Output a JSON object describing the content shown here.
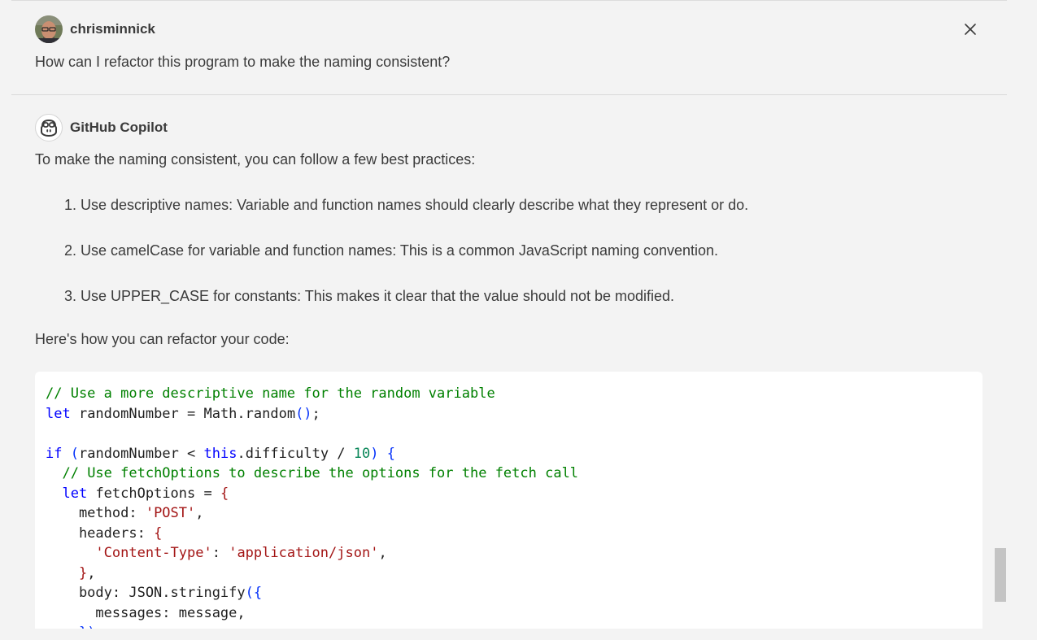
{
  "user_message": {
    "username": "chrisminnick",
    "avatar_icon": "user-avatar-photo",
    "text": "How can I refactor this program to make the naming consistent?"
  },
  "close_icon": "close-icon",
  "assistant_message": {
    "name": "GitHub Copilot",
    "avatar_icon": "copilot-icon",
    "intro": "To make the naming consistent, you can follow a few best practices:",
    "practices": [
      "1. Use descriptive names: Variable and function names should clearly describe what they represent or do.",
      "2. Use camelCase for variable and function names: This is a common JavaScript naming convention.",
      "3. Use UPPER_CASE for constants: This makes it clear that the value should not be modified."
    ],
    "refactor_intro": "Here's how you can refactor your code:",
    "code_language": "javascript",
    "code_lines": [
      [
        [
          "comment",
          "// Use a more descriptive name for the random variable"
        ]
      ],
      [
        [
          "kw",
          "let"
        ],
        [
          "plain",
          " randomNumber = Math.random"
        ],
        [
          "b1",
          "()"
        ],
        [
          "plain",
          ";"
        ]
      ],
      [
        [
          "plain",
          ""
        ]
      ],
      [
        [
          "kw",
          "if"
        ],
        [
          "plain",
          " "
        ],
        [
          "b1",
          "("
        ],
        [
          "plain",
          "randomNumber < "
        ],
        [
          "kw",
          "this"
        ],
        [
          "plain",
          ".difficulty / "
        ],
        [
          "num",
          "10"
        ],
        [
          "b1",
          ")"
        ],
        [
          "plain",
          " "
        ],
        [
          "b1",
          "{"
        ]
      ],
      [
        [
          "plain",
          "  "
        ],
        [
          "comment",
          "// Use fetchOptions to describe the options for the fetch call"
        ]
      ],
      [
        [
          "plain",
          "  "
        ],
        [
          "kw",
          "let"
        ],
        [
          "plain",
          " fetchOptions = "
        ],
        [
          "b2",
          "{"
        ]
      ],
      [
        [
          "plain",
          "    method: "
        ],
        [
          "str",
          "'POST'"
        ],
        [
          "plain",
          ","
        ]
      ],
      [
        [
          "plain",
          "    headers: "
        ],
        [
          "b2",
          "{"
        ]
      ],
      [
        [
          "plain",
          "      "
        ],
        [
          "str",
          "'Content-Type'"
        ],
        [
          "plain",
          ": "
        ],
        [
          "str",
          "'application/json'"
        ],
        [
          "plain",
          ","
        ]
      ],
      [
        [
          "plain",
          "    "
        ],
        [
          "b2",
          "}"
        ],
        [
          "plain",
          ","
        ]
      ],
      [
        [
          "plain",
          "    body: JSON.stringify"
        ],
        [
          "b3",
          "({"
        ]
      ],
      [
        [
          "plain",
          "      messages: message,"
        ]
      ],
      [
        [
          "plain",
          "    "
        ],
        [
          "b3",
          "})"
        ]
      ]
    ]
  }
}
